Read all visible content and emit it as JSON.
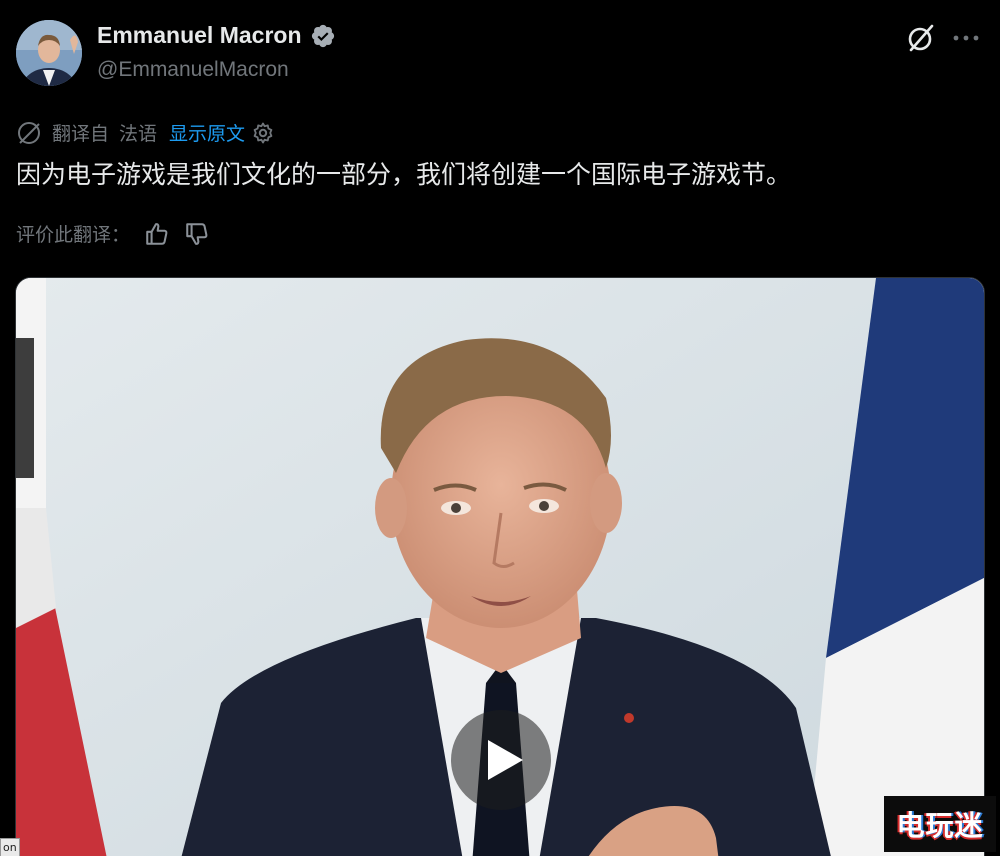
{
  "author": {
    "display_name": "Emmanuel Macron",
    "handle": "@EmmanuelMacron",
    "verified": true
  },
  "translation": {
    "translated_from": "翻译自",
    "source_language": "法语",
    "show_original": "显示原文"
  },
  "tweet": {
    "text": "因为电子游戏是我们文化的一部分，我们将创建一个国际电子游戏节。"
  },
  "rate_translation": {
    "label": "评价此翻译："
  },
  "media": {
    "type": "video"
  },
  "watermark": {
    "text": "电玩迷"
  },
  "corner_tag": {
    "text": "on"
  },
  "icons": {
    "verified": "verified-badge-icon",
    "grok": "grok-icon",
    "more": "more-dots-icon",
    "globe": "translate-globe-icon",
    "settings": "gear-icon",
    "thumbs_up": "thumbs-up-icon",
    "thumbs_down": "thumbs-down-icon",
    "play": "play-icon"
  },
  "colors": {
    "background": "#000000",
    "text_primary": "#e7e9ea",
    "text_secondary": "#71767b",
    "link": "#1d9bf0"
  }
}
